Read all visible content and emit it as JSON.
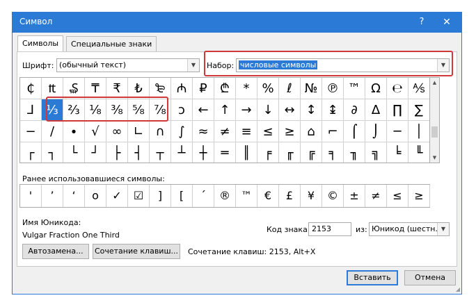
{
  "window": {
    "title": "Символ",
    "help_label": "?",
    "close_label": "✕"
  },
  "tabs": [
    {
      "label": "Символы",
      "active": true
    },
    {
      "label": "Специальные знаки",
      "active": false
    }
  ],
  "font": {
    "label": "Шрифт:",
    "value": "(обычный текст)"
  },
  "subset": {
    "label": "Набор:",
    "value": "числовые символы"
  },
  "symbol_grid": {
    "rows": [
      [
        "₵",
        "₶",
        "₷",
        "₸",
        "₹",
        "₺",
        "₻",
        "₼",
        "₽",
        "₾",
        "*",
        "%",
        "ℓ",
        "№",
        "℗",
        "™",
        "Ω",
        "℮",
        "⅍"
      ],
      [
        "⅃",
        "⅓",
        "⅔",
        "⅛",
        "⅜",
        "⅝",
        "⅞",
        "ↄ",
        "←",
        "↑",
        "→",
        "↓",
        "↔",
        "↕",
        "↨",
        "∂",
        "∆",
        "∏",
        "∑"
      ],
      [
        "−",
        "∕",
        "∙",
        "√",
        "∞",
        "∟",
        "∩",
        "∫",
        "≈",
        "≠",
        "≡",
        "≤",
        "≥",
        "⌂",
        "⌐",
        "⌠",
        "⌡",
        "─",
        "│"
      ],
      [
        "┌",
        "┐",
        "└",
        "┘",
        "├",
        "┤",
        "┬",
        "┴",
        "┼",
        "═",
        "║",
        "╒",
        "╓",
        "╔",
        "╕",
        "╖",
        "╗",
        "╘",
        "╙"
      ]
    ],
    "selected": "⅓"
  },
  "recent": {
    "label": "Ранее использовавшиеся символы:",
    "symbols": [
      "'",
      "’",
      "‘",
      "o",
      "✓",
      "☑",
      "]",
      "[",
      "´",
      "®",
      "™",
      "€",
      "£",
      "¥",
      "©",
      "±",
      "≠",
      "≤",
      "≥"
    ]
  },
  "unicode_name": {
    "label": "Имя Юникода:",
    "value": "Vulgar Fraction One Third"
  },
  "char_code": {
    "label": "Код знака:",
    "value": "2153"
  },
  "from": {
    "label": "из:",
    "value": "Юникод (шестн.)"
  },
  "buttons": {
    "autocorrect": "Автозамена...",
    "shortcut_key": "Сочетание клавиш...",
    "insert": "Вставить",
    "cancel": "Отмена"
  },
  "shortcut_text": "Сочетание клавиш: 2153, Alt+X",
  "colors": {
    "accent": "#2b7bd6",
    "highlight": "#d0383c"
  }
}
